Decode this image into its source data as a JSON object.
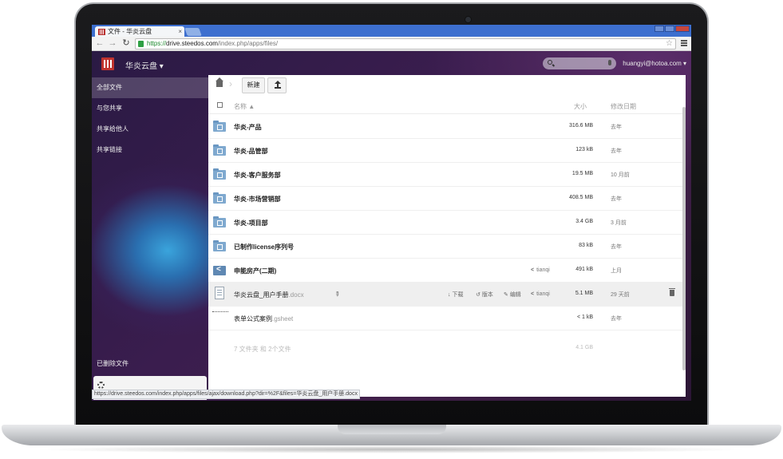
{
  "browser": {
    "tab_title": "文件 - 华炎云盘",
    "tab_close": "×",
    "url_scheme": "https://",
    "url_host": "drive.steedos.com",
    "url_path": "/index.php/apps/files/",
    "status_url": "https://drive.steedos.com/index.php/apps/files/ajax/download.php?dir=%2F&files=华炎云盘_用户手册.docx"
  },
  "header": {
    "app_name": "华炎云盘 ▾",
    "user": "huangyi@hotoa.com ▾"
  },
  "sidebar": {
    "items": [
      {
        "label": "全部文件"
      },
      {
        "label": "与您共享"
      },
      {
        "label": "共享给他人"
      },
      {
        "label": "共享链接"
      }
    ],
    "trash_label": "已删除文件"
  },
  "controls": {
    "new_label": "新建"
  },
  "table": {
    "col_name": "名称 ▲",
    "col_size": "大小",
    "col_date": "修改日期"
  },
  "files": [
    {
      "name": "华炎-产品",
      "size": "316.6 MB",
      "date": "去年"
    },
    {
      "name": "华炎-品管部",
      "size": "123 kB",
      "date": "去年"
    },
    {
      "name": "华炎-客户服务部",
      "size": "19.5 MB",
      "date": "10 月前"
    },
    {
      "name": "华炎-市场营销部",
      "size": "408.5 MB",
      "date": "去年"
    },
    {
      "name": "华炎-项目部",
      "size": "3.4 GB",
      "date": "3 月前"
    },
    {
      "name": "已制作license序列号",
      "size": "83 kB",
      "date": "去年"
    },
    {
      "name": "申能房产(二期)",
      "shared_by": "tianqi",
      "size": "491 kB",
      "date": "上月"
    },
    {
      "name": "华炎云盘_用户手册",
      "ext": ".docx",
      "size": "5.1 MB",
      "date": "29 天前",
      "actions": {
        "download": "下载",
        "versions": "版本",
        "edit": "编辑",
        "share": "tianqi"
      }
    },
    {
      "name": "表单公式案例",
      "ext": ".gsheet",
      "size": "< 1 kB",
      "date": "去年"
    }
  ],
  "summary": {
    "files": "7 文件夹 和 2个文件",
    "size": "4.1 GB"
  },
  "colors": {
    "tabbar": "#3d6fcf",
    "folder": "#7fa9cf",
    "url_green": "#1d8a2e"
  }
}
